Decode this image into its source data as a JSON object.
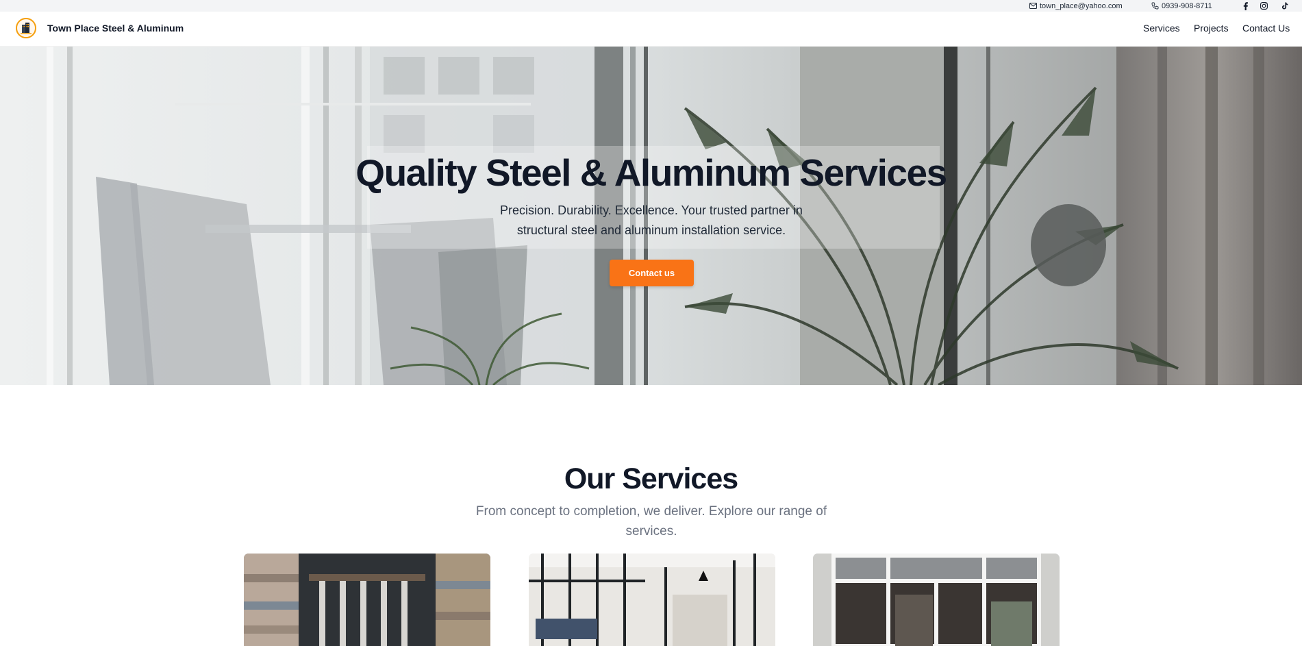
{
  "topbar": {
    "email": "town_place@yahoo.com",
    "phone": "0939-908-8711",
    "icons": [
      "mail-icon",
      "phone-icon",
      "facebook-icon",
      "instagram-icon",
      "tiktok-icon"
    ]
  },
  "navbar": {
    "brand": "Town Place Steel & Aluminum",
    "links": [
      {
        "label": "Services"
      },
      {
        "label": "Projects"
      },
      {
        "label": "Contact Us"
      }
    ]
  },
  "hero": {
    "title": "Quality Steel & Aluminum Services",
    "subtitle": "Precision. Durability. Excellence. Your trusted partner in structural steel and aluminum installation service.",
    "cta_label": "Contact us"
  },
  "services": {
    "title": "Our Services",
    "subtitle": "From concept to completion, we deliver. Explore our range of services."
  },
  "colors": {
    "accent": "#f97316",
    "text_dark": "#111827",
    "text_muted": "#6b7280",
    "topbar_bg": "#f3f4f6"
  }
}
